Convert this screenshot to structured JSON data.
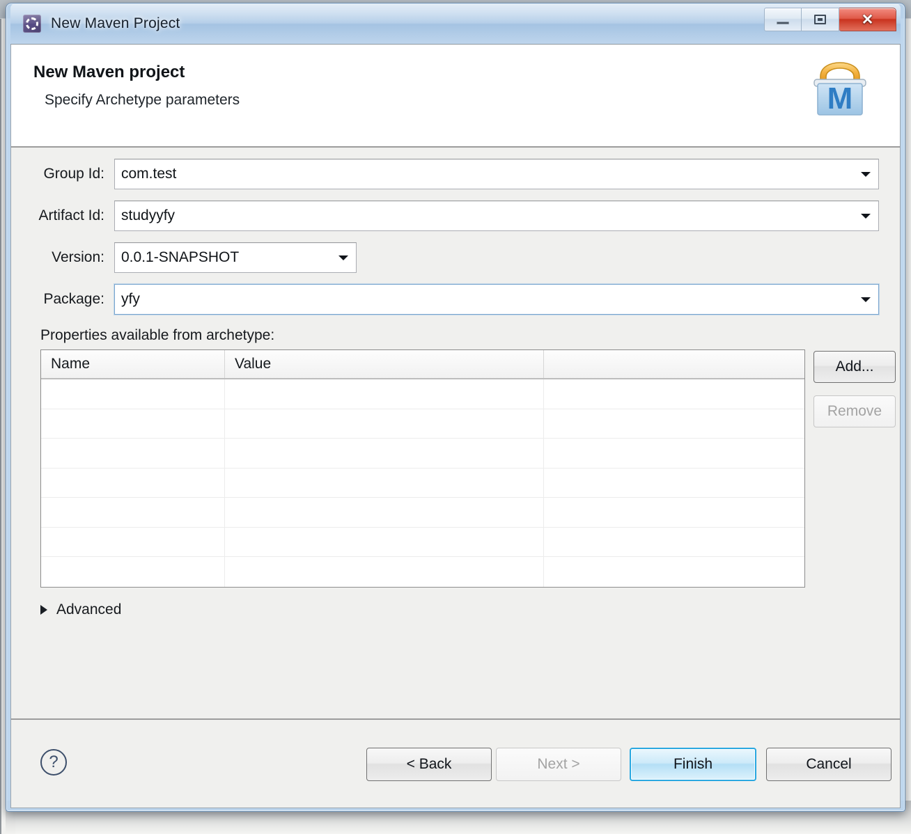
{
  "window": {
    "title": "New Maven Project",
    "app_icon": "maven-gear-icon",
    "controls": {
      "minimize": "minimize-icon",
      "restore": "restore-icon",
      "close": "✕"
    }
  },
  "header": {
    "title": "New Maven project",
    "subtitle": "Specify Archetype parameters",
    "logo": "maven-folder-m-icon"
  },
  "form": {
    "fields": [
      {
        "label": "Group Id:",
        "value": "com.test",
        "type": "combo",
        "focused": false
      },
      {
        "label": "Artifact Id:",
        "value": "studyyfy",
        "type": "combo",
        "focused": false
      },
      {
        "label": "Version:",
        "value": "0.0.1-SNAPSHOT",
        "type": "combo",
        "focused": false
      },
      {
        "label": "Package:",
        "value": "yfy",
        "type": "combo",
        "focused": true
      }
    ]
  },
  "properties": {
    "label": "Properties available from archetype:",
    "columns": [
      "Name",
      "Value",
      ""
    ],
    "rows": [],
    "empty_row_count": 7,
    "add_label": "Add...",
    "remove_label": "Remove",
    "remove_enabled": false,
    "add_enabled": true
  },
  "advanced": {
    "label": "Advanced",
    "expanded": false,
    "triangle": "chevron-right-icon"
  },
  "footer": {
    "help": "?",
    "back_label": "< Back",
    "next_label": "Next >",
    "next_enabled": false,
    "finish_label": "Finish",
    "finish_is_default": true,
    "cancel_label": "Cancel"
  },
  "colors": {
    "titlebar_glass": "#bad4ee",
    "dialog_face": "#f0f0ee",
    "header_white": "#ffffff",
    "default_button_accent": "#2aa8e0",
    "close_button_red": "#c9331f",
    "focus_border": "#7aa6cf",
    "disabled_text": "#a3a3a3"
  }
}
